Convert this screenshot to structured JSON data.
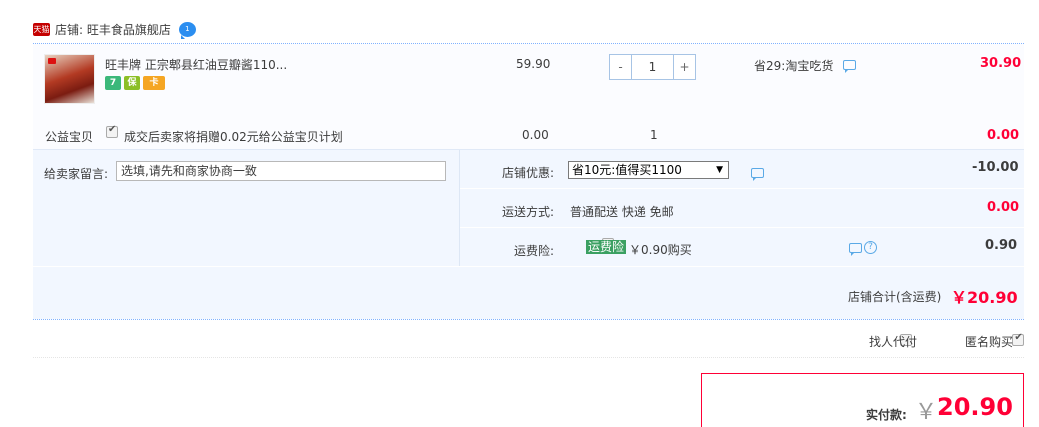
{
  "shop": {
    "badge": "天猫",
    "name": "店铺: 旺丰食品旗舰店",
    "chat_badge": "1"
  },
  "item": {
    "title": "旺丰牌 正宗郫县红油豆瓣酱110...",
    "service_icons": [
      "7",
      "保",
      "卡"
    ],
    "price": "59.90",
    "qty_minus": "-",
    "qty_value": "1",
    "qty_plus": "+",
    "discount": "省29:淘宝吃货",
    "subtotal": "30.90"
  },
  "charity": {
    "label": "公益宝贝",
    "text": "成交后卖家将捐赠0.02元给公益宝贝计划",
    "price": "0.00",
    "qty": "1",
    "total": "0.00"
  },
  "note": {
    "label": "给卖家留言:",
    "placeholder": "选填,请先和商家协商一致"
  },
  "promo": {
    "label": "店铺优惠:",
    "selected": "省10元:值得买1100",
    "value": "-10.00"
  },
  "shipping": {
    "label": "运送方式:",
    "method": "普通配送 快递 免邮",
    "value": "0.00"
  },
  "insurance": {
    "label": "运费险:",
    "tag": "运费险",
    "text": "￥0.90购买",
    "help": "?",
    "value": "0.90"
  },
  "store_total": {
    "label": "店铺合计(含运费)",
    "value": "￥20.90"
  },
  "options": {
    "proxy_pay": "找人代付",
    "anonymous": "匿名购买"
  },
  "payment": {
    "label": "实付款:",
    "currency": "￥",
    "value": "20.90"
  },
  "colors": {
    "accent_red": "#ff0036",
    "panel_bg": "#f2f7ff",
    "link_blue": "#5aa9e6"
  }
}
